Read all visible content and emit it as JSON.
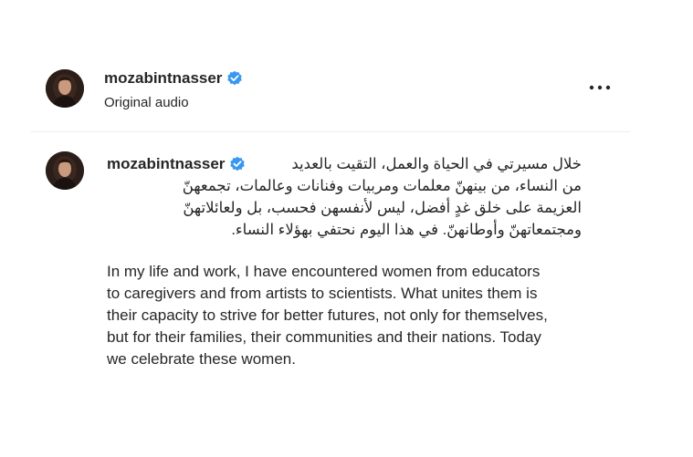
{
  "post": {
    "username": "mozabintnasser",
    "subtitle": "Original audio",
    "more_label": "More options",
    "verified_color": "#3897f0"
  },
  "comment": {
    "username": "mozabintnasser",
    "arabic_lines": [
      "خلال مسيرتي في الحياة والعمل، التقيت بالعديد",
      "من النساء، من بينهنّ معلمات ومربيات وفنانات وعالمات، تجمعهنّ",
      "العزيمة على خلق غدٍ أفضل، ليس لأنفسهن فحسب، بل ولعائلاتهنّ",
      "ومجتمعاتهنّ وأوطانهنّ. في هذا اليوم نحتفي بهؤلاء النساء."
    ],
    "english_lines": [
      "In my life and work, I have encountered women from educators",
      "to caregivers and from artists to scientists. What unites them is",
      "their capacity to strive for better futures, not only for themselves,",
      "but for their families, their communities and their nations. Today",
      "we celebrate these women."
    ]
  }
}
